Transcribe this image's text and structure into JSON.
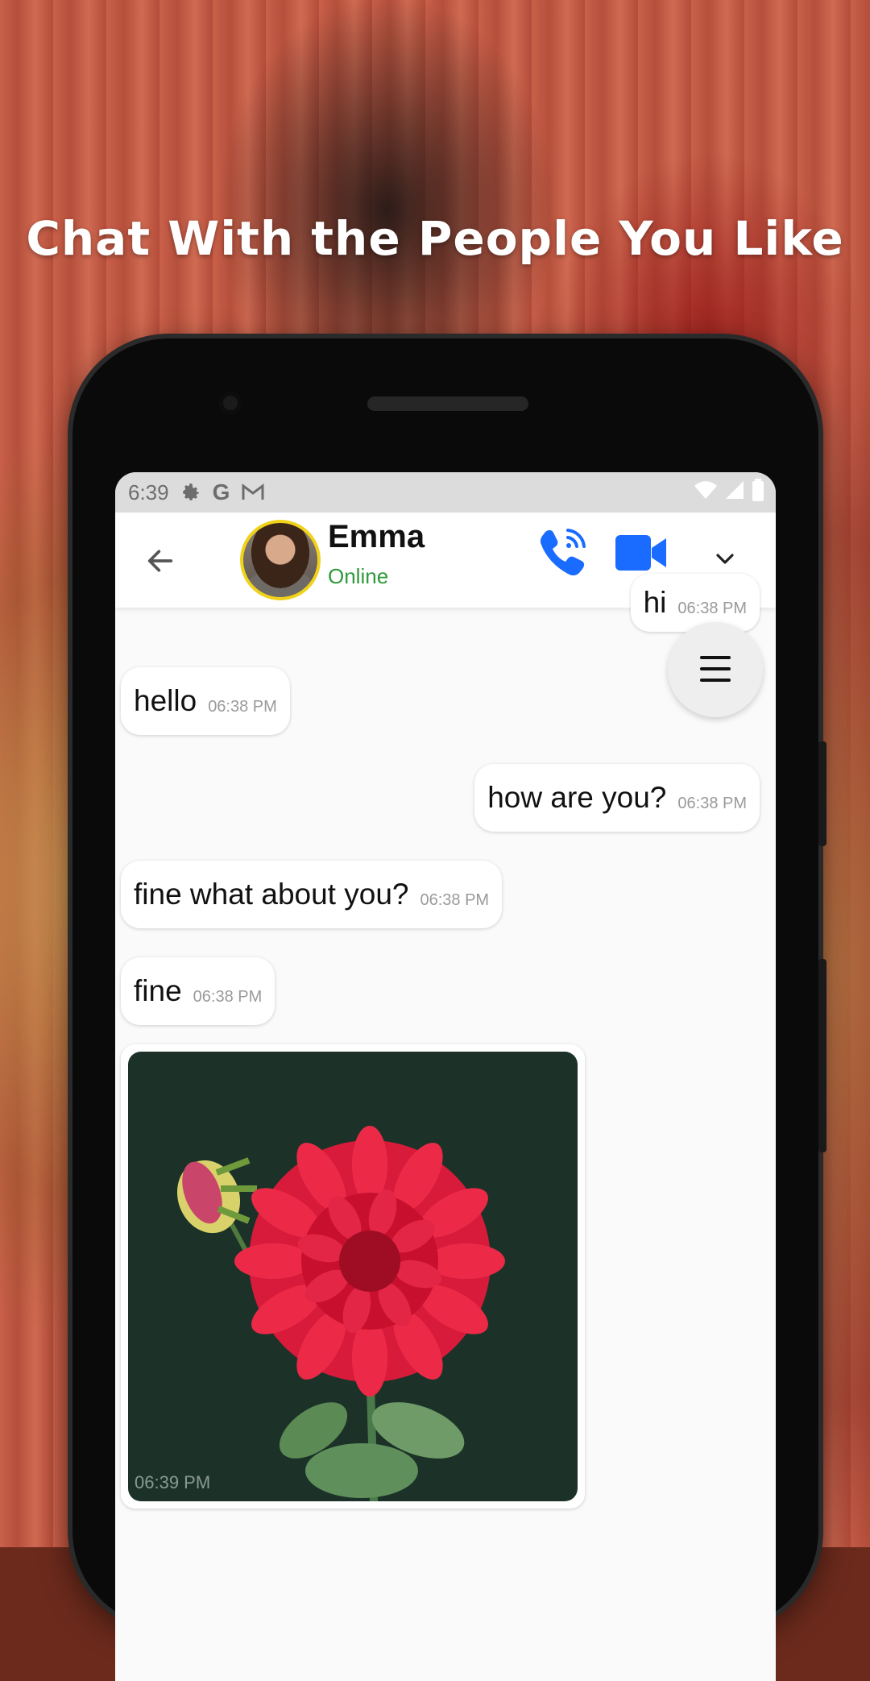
{
  "headline": "Chat With the People You Like",
  "status_bar": {
    "time": "6:39",
    "icons_left": [
      "gear-icon",
      "google-icon",
      "gmail-icon"
    ],
    "icons_right": [
      "wifi-icon",
      "signal-icon",
      "battery-icon"
    ]
  },
  "contact": {
    "name": "Emma",
    "status": "Online"
  },
  "colors": {
    "online": "#2e9a3a",
    "call": "#1a6bff",
    "avatar_ring": "#f0d21a"
  },
  "messages": [
    {
      "id": "m0",
      "side": "right",
      "text": "hi",
      "time": "06:38 PM",
      "partial": true
    },
    {
      "id": "m1",
      "side": "left",
      "text": "hello",
      "time": "06:38 PM"
    },
    {
      "id": "m2",
      "side": "right",
      "text": "how are you?",
      "time": "06:38 PM"
    },
    {
      "id": "m3",
      "side": "left",
      "text": "fine what about you?",
      "time": "06:38 PM"
    },
    {
      "id": "m4",
      "side": "left",
      "text": "fine",
      "time": "06:38 PM"
    }
  ],
  "image_message": {
    "time": "06:39 PM",
    "subject": "red dahlia flower"
  }
}
